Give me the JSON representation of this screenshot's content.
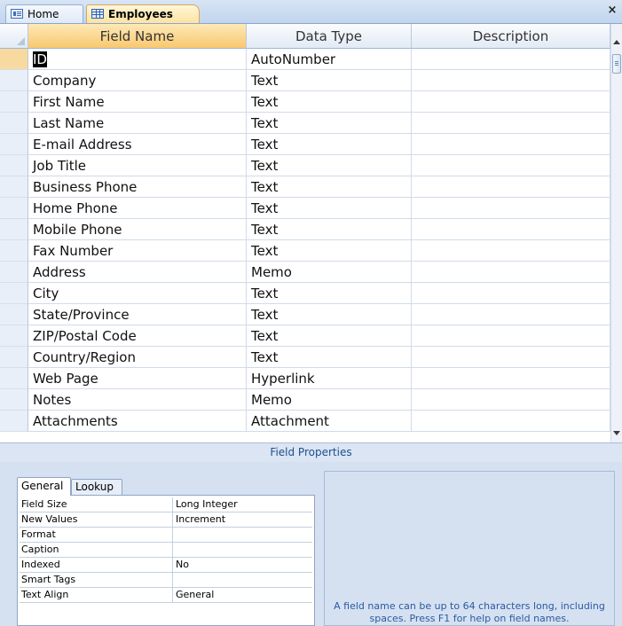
{
  "tabs": [
    {
      "label": "Home",
      "icon": "form-icon"
    },
    {
      "label": "Employees",
      "icon": "table-icon"
    }
  ],
  "close_label": "×",
  "grid": {
    "columns": [
      "Field Name",
      "Data Type",
      "Description"
    ],
    "rows": [
      {
        "field": "ID",
        "type": "AutoNumber",
        "desc": ""
      },
      {
        "field": "Company",
        "type": "Text",
        "desc": ""
      },
      {
        "field": "First Name",
        "type": "Text",
        "desc": ""
      },
      {
        "field": "Last Name",
        "type": "Text",
        "desc": ""
      },
      {
        "field": "E-mail Address",
        "type": "Text",
        "desc": ""
      },
      {
        "field": "Job Title",
        "type": "Text",
        "desc": ""
      },
      {
        "field": "Business Phone",
        "type": "Text",
        "desc": ""
      },
      {
        "field": "Home Phone",
        "type": "Text",
        "desc": ""
      },
      {
        "field": "Mobile Phone",
        "type": "Text",
        "desc": ""
      },
      {
        "field": "Fax Number",
        "type": "Text",
        "desc": ""
      },
      {
        "field": "Address",
        "type": "Memo",
        "desc": ""
      },
      {
        "field": "City",
        "type": "Text",
        "desc": ""
      },
      {
        "field": "State/Province",
        "type": "Text",
        "desc": ""
      },
      {
        "field": "ZIP/Postal Code",
        "type": "Text",
        "desc": ""
      },
      {
        "field": "Country/Region",
        "type": "Text",
        "desc": ""
      },
      {
        "field": "Web Page",
        "type": "Hyperlink",
        "desc": ""
      },
      {
        "field": "Notes",
        "type": "Memo",
        "desc": ""
      },
      {
        "field": "Attachments",
        "type": "Attachment",
        "desc": ""
      }
    ]
  },
  "field_properties": {
    "title": "Field Properties",
    "tabs": [
      "General",
      "Lookup"
    ],
    "active_tab": "General",
    "props": [
      {
        "name": "Field Size",
        "value": "Long Integer"
      },
      {
        "name": "New Values",
        "value": "Increment"
      },
      {
        "name": "Format",
        "value": ""
      },
      {
        "name": "Caption",
        "value": ""
      },
      {
        "name": "Indexed",
        "value": "No"
      },
      {
        "name": "Smart Tags",
        "value": ""
      },
      {
        "name": "Text Align",
        "value": "General"
      }
    ],
    "help_text": "A field name can be up to 64 characters long, including spaces.  Press F1 for help on field names."
  },
  "colors": {
    "active_tab": "#fde3a2",
    "header_highlight": "#f9c86e",
    "pane_background": "#d5e1f1",
    "help_text": "#2a5aa0"
  }
}
